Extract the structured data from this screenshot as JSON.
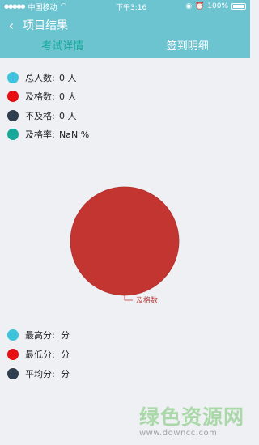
{
  "status_bar": {
    "carrier": "中国移动",
    "time": "下午3:16",
    "battery": "100%"
  },
  "header": {
    "title": "项目结果"
  },
  "tabs": [
    {
      "label": "考试详情",
      "active": true
    },
    {
      "label": "签到明细",
      "active": false
    }
  ],
  "stats": [
    {
      "label": "总人数:",
      "value": "0 人",
      "color": "#3ec3dc"
    },
    {
      "label": "及格数:",
      "value": "0 人",
      "color": "#e80f12"
    },
    {
      "label": "不及格:",
      "value": "0 人",
      "color": "#2f3e4e"
    },
    {
      "label": "及格率:",
      "value": "NaN %",
      "color": "#16a99a"
    }
  ],
  "chart_data": {
    "type": "pie",
    "categories": [
      "及格数"
    ],
    "values": [
      1
    ],
    "colors": [
      "#c23531"
    ]
  },
  "scores": [
    {
      "label": "最高分:",
      "value": "分",
      "color": "#3ec3dc"
    },
    {
      "label": "最低分:",
      "value": "分",
      "color": "#e80f12"
    },
    {
      "label": "平均分:",
      "value": "分",
      "color": "#2f3e4e"
    }
  ],
  "watermark": {
    "name": "绿色资源网",
    "url": "www.downcc.com"
  }
}
